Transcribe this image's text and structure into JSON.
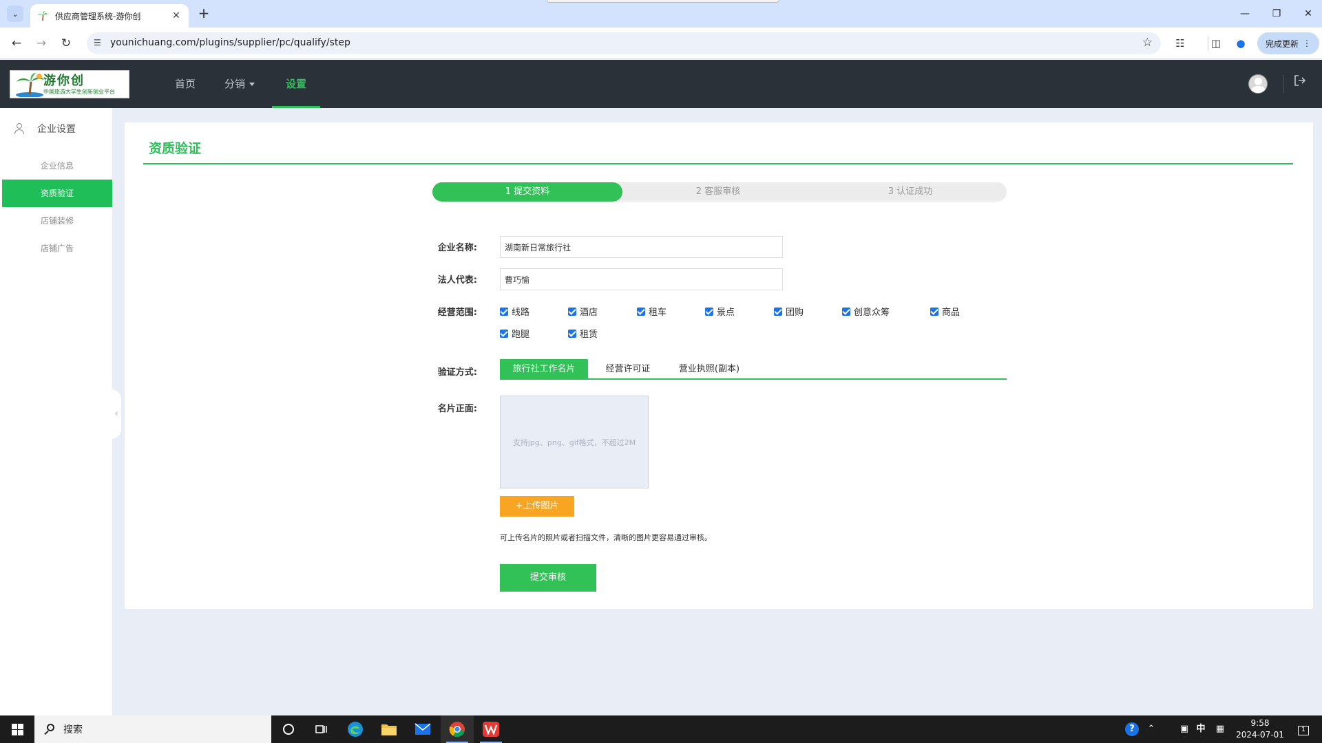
{
  "browser": {
    "tab_title": "供应商管理系统-游你创",
    "url": "younichuang.com/plugins/supplier/pc/qualify/step",
    "update_label": "完成更新"
  },
  "header": {
    "logo_title": "游你创",
    "logo_subtitle": "中国旅游大学生创新创业平台",
    "nav": [
      {
        "label": "首页"
      },
      {
        "label": "分销"
      },
      {
        "label": "设置"
      }
    ]
  },
  "sidebar": {
    "group_label": "企业设置",
    "items": [
      {
        "label": "企业信息"
      },
      {
        "label": "资质验证"
      },
      {
        "label": "店铺装修"
      },
      {
        "label": "店铺广告"
      }
    ]
  },
  "main": {
    "title": "资质验证",
    "steps": [
      {
        "label": "1 提交资料"
      },
      {
        "label": "2 客服审核"
      },
      {
        "label": "3 认证成功"
      }
    ],
    "company_label": "企业名称:",
    "company_value": "湖南新日常旅行社",
    "legal_label": "法人代表:",
    "legal_value": "曹巧愉",
    "scope_label": "经营范围:",
    "scope_items": [
      "线路",
      "酒店",
      "租车",
      "景点",
      "团购",
      "创意众筹",
      "商品",
      "跑腿",
      "租赁"
    ],
    "verify_label": "验证方式:",
    "verify_tabs": [
      "旅行社工作名片",
      "经营许可证",
      "营业执照(副本)"
    ],
    "card_label": "名片正面:",
    "upload_hint": "支持jpg、png、gif格式，不超过2M",
    "upload_button": "+上传图片",
    "upload_tip": "可上传名片的照片或者扫描文件，清晰的图片更容易通过审核。",
    "submit_button": "提交审核"
  },
  "taskbar": {
    "search_placeholder": "搜索",
    "ime": "中",
    "time": "9:58",
    "date": "2024-07-01",
    "notification_count": "1"
  },
  "colors": {
    "accent_green": "#2dc05a",
    "header_dark": "#2a3139",
    "upload_orange": "#f7a522",
    "checkbox_blue": "#1a73e8"
  }
}
